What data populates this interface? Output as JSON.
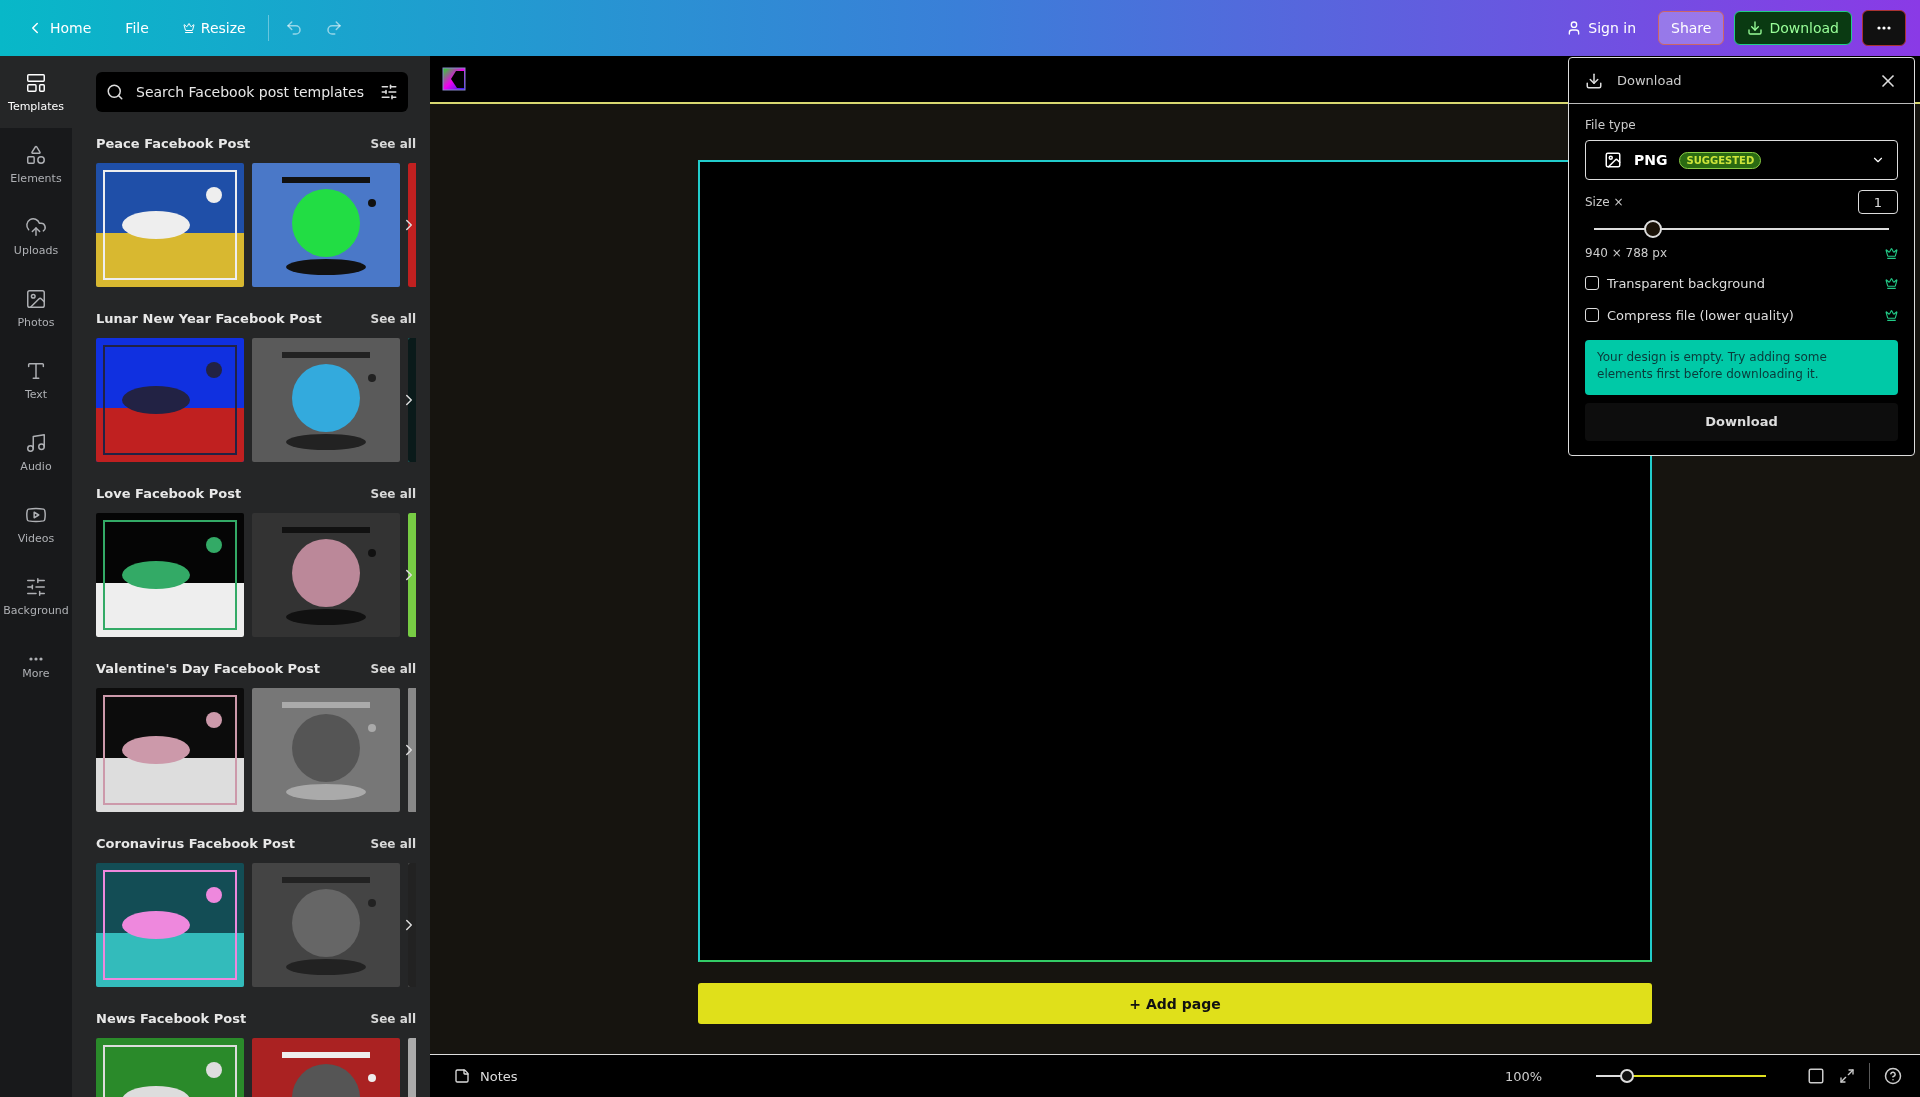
{
  "top_bar": {
    "home": "Home",
    "file": "File",
    "resize": "Resize",
    "sign_in": "Sign in",
    "share": "Share",
    "download": "Download"
  },
  "sidebar": {
    "items": [
      {
        "label": "Templates",
        "selected": true
      },
      {
        "label": "Elements",
        "selected": false
      },
      {
        "label": "Uploads",
        "selected": false
      },
      {
        "label": "Photos",
        "selected": false
      },
      {
        "label": "Text",
        "selected": false
      },
      {
        "label": "Audio",
        "selected": false
      },
      {
        "label": "Videos",
        "selected": false
      },
      {
        "label": "Background",
        "selected": false
      },
      {
        "label": "More",
        "selected": false
      }
    ]
  },
  "templates_panel": {
    "search": {
      "placeholder": "Search Facebook post templates"
    },
    "sections": [
      {
        "title": "Peace Facebook Post",
        "link": "See all"
      },
      {
        "title": "Lunar New Year Facebook Post",
        "link": "See all"
      },
      {
        "title": "Love Facebook Post",
        "link": "See all"
      },
      {
        "title": "Valentine's Day Facebook Post",
        "link": "See all"
      },
      {
        "title": "Coronavirus Facebook Post",
        "link": "See all"
      },
      {
        "title": "News Facebook Post",
        "link": "See all"
      }
    ]
  },
  "canvas": {
    "add_page": "+ Add page"
  },
  "download_panel": {
    "title": "Download",
    "file_type_label": "File type",
    "file_type": {
      "value": "PNG",
      "badge": "SUGGESTED"
    },
    "size_label": "Size ×",
    "size_value": "1",
    "size_slider": {
      "level": 0.2
    },
    "dimensions": "940 × 788 px",
    "dimensions_premium": true,
    "options": [
      {
        "label": "Transparent background",
        "checked": false,
        "premium": true
      },
      {
        "label": "Compress file (lower quality)",
        "checked": false,
        "premium": true
      }
    ],
    "notice": "Your design is empty. Try adding some elements first before downloading it.",
    "button": "Download"
  },
  "bottom_bar": {
    "notes": "Notes",
    "zoom": "100%",
    "zoom_slider": {
      "level": 0.18
    }
  }
}
